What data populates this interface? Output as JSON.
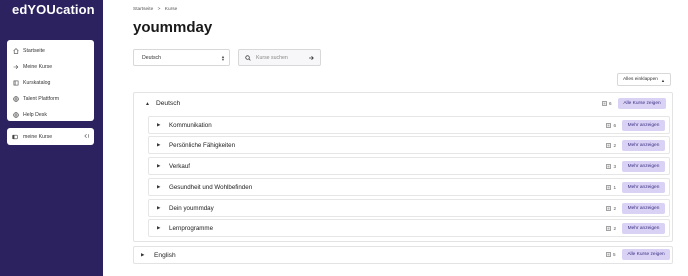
{
  "brand": {
    "logo_text": "edYOUcation"
  },
  "sidebar": {
    "items": [
      {
        "label": "Startseite",
        "icon": "home-icon"
      },
      {
        "label": "Meine Kurse",
        "icon": "arrow-right-icon"
      },
      {
        "label": "Kurskatalog",
        "icon": "book-icon"
      },
      {
        "label": "Talent Plattform",
        "icon": "globe-icon"
      },
      {
        "label": "Help Desk",
        "icon": "globe-icon"
      }
    ],
    "my_courses": {
      "label": "meine Kurse",
      "icon": "toggle-panel-icon",
      "collapse_icon": "collapse-sidebar-icon"
    }
  },
  "breadcrumb": {
    "items": [
      "Startseite",
      "Kurse"
    ],
    "separator": ">"
  },
  "page": {
    "title": "yoummday"
  },
  "filters": {
    "language_value": "Deutsch",
    "search_placeholder": "Kurse suchen",
    "collapse_all_label": "Alles einklappen"
  },
  "groups": {
    "deutsch": {
      "label": "Deutsch",
      "count": "6",
      "all_label": "Alle Kurse zeigen",
      "subcategories": [
        {
          "label": "Kommunikation",
          "count": "6",
          "more_label": "Mehr anzeigen"
        },
        {
          "label": "Persönliche Fähigkeiten",
          "count": "2",
          "more_label": "Mehr anzeigen"
        },
        {
          "label": "Verkauf",
          "count": "3",
          "more_label": "Mehr anzeigen"
        },
        {
          "label": "Gesundheit und Wohlbefinden",
          "count": "1",
          "more_label": "Mehr anzeigen"
        },
        {
          "label": "Dein yoummday",
          "count": "2",
          "more_label": "Mehr anzeigen"
        },
        {
          "label": "Lernprogramme",
          "count": "2",
          "more_label": "Mehr anzeigen"
        }
      ]
    },
    "english": {
      "label": "English",
      "count": "5",
      "all_label": "Alle Kurse zeigen"
    }
  },
  "colors": {
    "sidebar_bg": "#2d2260",
    "button_bg": "#d9d2f5",
    "button_text": "#3a2e80"
  }
}
